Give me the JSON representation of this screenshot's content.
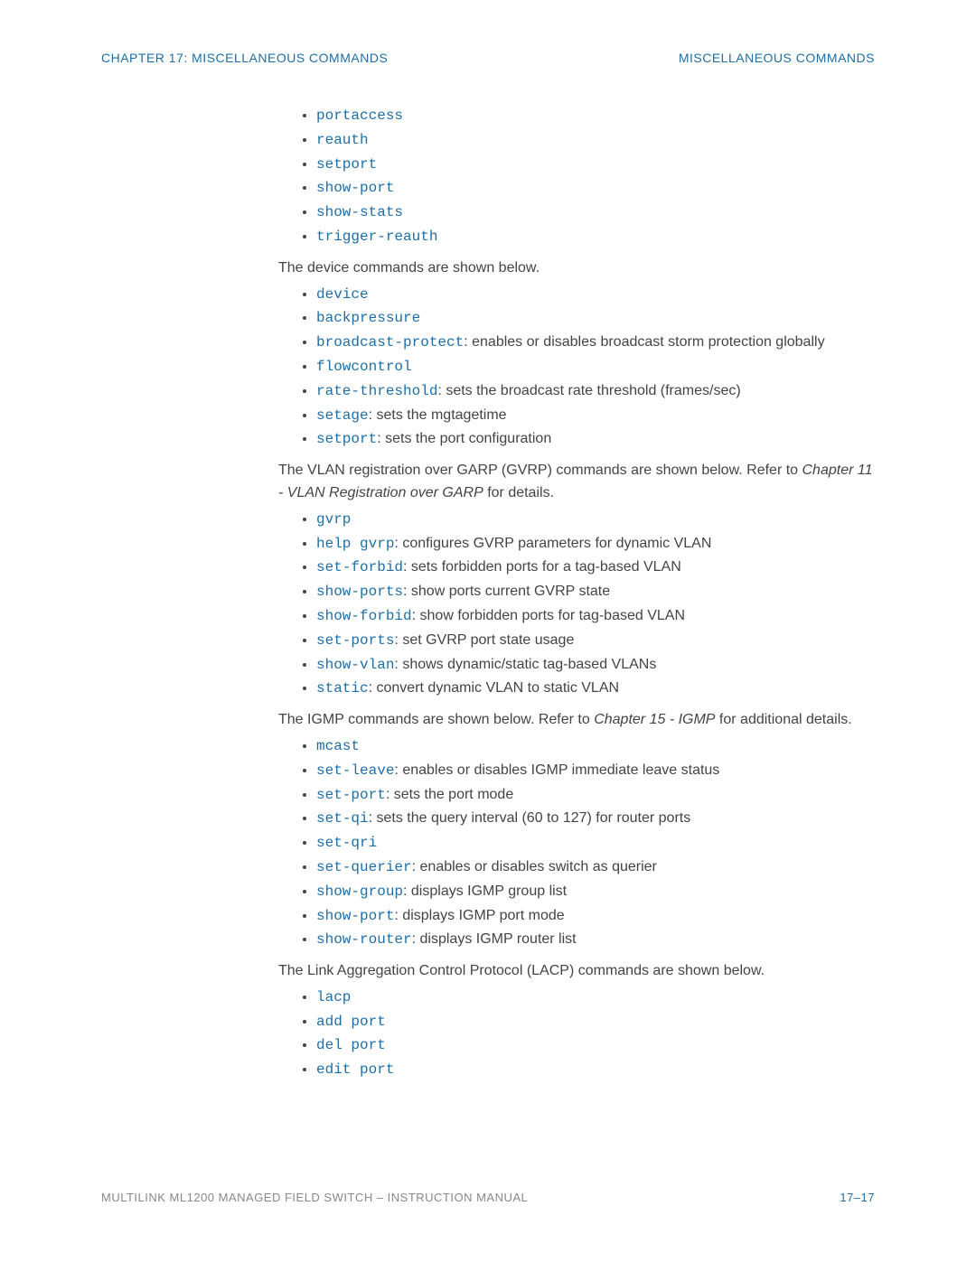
{
  "header": {
    "left": "CHAPTER 17: MISCELLANEOUS COMMANDS",
    "right": "MISCELLANEOUS COMMANDS"
  },
  "footer": {
    "left": "MULTILINK ML1200 MANAGED FIELD SWITCH – INSTRUCTION MANUAL",
    "right": "17–17"
  },
  "lists": {
    "first": {
      "items": [
        {
          "cmd": "portaccess"
        },
        {
          "cmd": "reauth"
        },
        {
          "cmd": "setport"
        },
        {
          "cmd": "show-port"
        },
        {
          "cmd": "show-stats"
        },
        {
          "cmd": "trigger-reauth"
        }
      ]
    },
    "device": {
      "intro": "The device commands are shown below.",
      "items": [
        {
          "cmd": "device"
        },
        {
          "cmd": "backpressure"
        },
        {
          "cmd": "broadcast-protect",
          "desc": ": enables or disables broadcast storm protection globally"
        },
        {
          "cmd": "flowcontrol"
        },
        {
          "cmd": "rate-threshold",
          "desc": ": sets the broadcast rate threshold (frames/sec)"
        },
        {
          "cmd": "setage",
          "desc": ": sets the mgtagetime"
        },
        {
          "cmd": "setport",
          "desc": ": sets the port configuration"
        }
      ]
    },
    "gvrp": {
      "intro_pre": "The VLAN registration over GARP (GVRP) commands are shown below. Refer to ",
      "intro_em": "Chapter 11 - VLAN Registration over GARP",
      "intro_post": " for details.",
      "items": [
        {
          "cmd": "gvrp"
        },
        {
          "cmd": "help gvrp",
          "desc": ": configures GVRP parameters for dynamic VLAN"
        },
        {
          "cmd": "set-forbid",
          "desc": ": sets forbidden ports for a tag-based VLAN"
        },
        {
          "cmd": "show-ports",
          "desc": ": show ports current GVRP state"
        },
        {
          "cmd": "show-forbid",
          "desc": ": show forbidden ports for tag-based VLAN"
        },
        {
          "cmd": "set-ports",
          "desc": ": set GVRP port state usage"
        },
        {
          "cmd": "show-vlan",
          "desc": ": shows dynamic/static tag-based VLANs"
        },
        {
          "cmd": "static",
          "desc": ": convert dynamic VLAN to static VLAN"
        }
      ]
    },
    "igmp": {
      "intro_pre": "The IGMP commands are shown below. Refer to ",
      "intro_em": "Chapter 15 - IGMP",
      "intro_post": " for additional details.",
      "items": [
        {
          "cmd": "mcast"
        },
        {
          "cmd": "set-leave",
          "desc": ": enables or disables IGMP immediate leave status"
        },
        {
          "cmd": "set-port",
          "desc": ": sets the port mode"
        },
        {
          "cmd": "set-qi",
          "desc": ": sets the query interval (60 to 127) for router ports"
        },
        {
          "cmd": "set-qri"
        },
        {
          "cmd": "set-querier",
          "desc": ": enables or disables switch as querier"
        },
        {
          "cmd": "show-group",
          "desc": ": displays IGMP group list"
        },
        {
          "cmd": "show-port",
          "desc": ": displays IGMP port mode"
        },
        {
          "cmd": "show-router",
          "desc": ": displays IGMP router list"
        }
      ]
    },
    "lacp": {
      "intro": "The Link Aggregation Control Protocol (LACP) commands are shown below.",
      "items": [
        {
          "cmd": "lacp"
        },
        {
          "cmd": "add port"
        },
        {
          "cmd": "del port"
        },
        {
          "cmd": "edit port"
        }
      ]
    }
  }
}
